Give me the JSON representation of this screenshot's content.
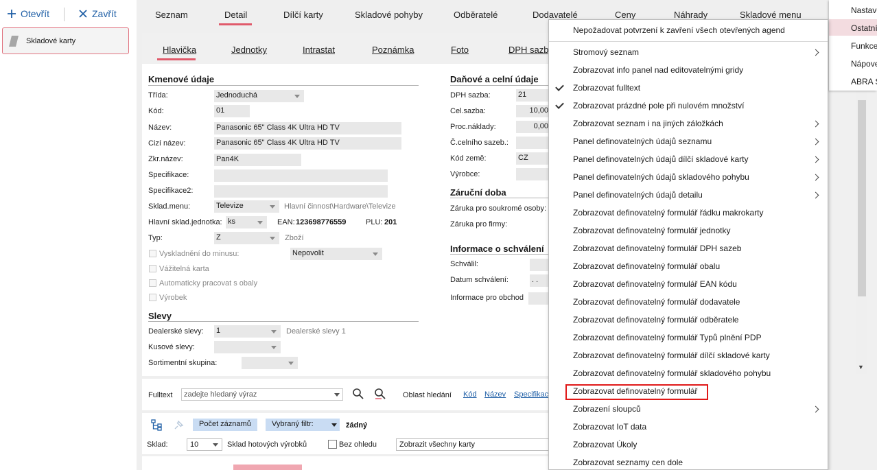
{
  "toolbar": {
    "open_label": "Otevřít",
    "close_label": "Zavřít"
  },
  "sidebar": {
    "card_label": "Skladové karty"
  },
  "top_tabs": [
    "Seznam",
    "Detail",
    "Dílčí karty",
    "Skladové pohyby",
    "Odběratelé",
    "Dodavatelé",
    "Ceny",
    "Náhrady",
    "Skladové menu"
  ],
  "sub_tabs": [
    "Hlavička",
    "Jednotky",
    "Intrastat",
    "Poznámka",
    "Foto",
    "DPH sazby"
  ],
  "left_form": {
    "section1": "Kmenové údaje",
    "trida_label": "Třída:",
    "trida_value": "Jednoduchá",
    "kod_label": "Kód:",
    "kod_value": "01",
    "nazev_label": "Název:",
    "nazev_value": "Panasonic 65\" Class 4K Ultra HD TV",
    "cizi_label": "Cizí název:",
    "cizi_value": "Panasonic 65\" Class 4K Ultra HD TV",
    "zkr_label": "Zkr.název:",
    "zkr_value": "Pan4K",
    "spec_label": "Specifikace:",
    "spec2_label": "Specifikace2:",
    "sklad_menu_label": "Sklad.menu:",
    "sklad_menu_value": "Televize",
    "sklad_menu_path": "Hlavní činnost\\Hardware\\Televize",
    "jednotka_label": "Hlavní sklad.jednotka:",
    "jednotka_value": "ks",
    "ean_label": "EAN:",
    "ean_value": "123698776559",
    "plu_label": "PLU:",
    "plu_value": "201",
    "typ_label": "Typ:",
    "typ_value": "Z",
    "typ_text": "Zboží",
    "vysk_label": "Vyskladnění do minusu:",
    "vysk_value": "Nepovolit",
    "vazitelna_label": "Vážitelná karta",
    "obaly_label": "Automaticky pracovat s obaly",
    "vyrobek_label": "Výrobek",
    "section2": "Slevy",
    "dealer_label": "Dealerské slevy:",
    "dealer_value": "1",
    "dealer_text": "Dealerské slevy 1",
    "kusove_label": "Kusové slevy:",
    "sortiment_label": "Sortimentní skupina:"
  },
  "right_form": {
    "section1": "Daňové a celní údaje",
    "dph_label": "DPH sazba:",
    "dph_value": "21",
    "cel_label": "Cel.sazba:",
    "cel_value": "10,00",
    "proc_label": "Proc.náklady:",
    "proc_value": "0,00",
    "celni_label": "Č.celního sazeb.:",
    "zeme_label": "Kód země:",
    "zeme_value": "CZ",
    "vyrobce_label": "Výrobce:",
    "section2": "Záruční doba",
    "soukr_label": "Záruka pro soukromé osoby:",
    "firmy_label": "Záruka pro firmy:",
    "section3": "Informace o schválení",
    "schvalil_label": "Schválil:",
    "datum_label": "Datum schválení:",
    "datum_value": ". .",
    "obchod_label": "Informace pro obchod"
  },
  "fulltext": {
    "label": "Fulltext",
    "placeholder": "zadejte hledaný výraz",
    "oblast_label": "Oblast hledání",
    "links": [
      "Kód",
      "Název",
      "Specifikace"
    ]
  },
  "bottom": {
    "pocet_label": "Počet záznamů",
    "filtr_label": "Vybraný filtr:",
    "filtr_value": "žádný",
    "sklad_label": "Sklad:",
    "sklad_value": "10",
    "sklad_name": "Sklad hotových výrobků",
    "bez_label": "Bez ohledu",
    "karty_value": "Zobrazit všechny karty"
  },
  "right_menu": [
    "Nastave",
    "Ostatní",
    "Funkce",
    "Nápove",
    "ABRA S"
  ],
  "context_menu": [
    "Nepožadovat potvrzení k zavření všech otevřených agend",
    "Stromový seznam",
    "Zobrazovat info panel nad editovatelnými gridy",
    "Zobrazovat fulltext",
    "Zobrazovat prázdné pole při nulovém množství",
    "Zobrazovat seznam i na jiných záložkách",
    "Panel definovatelných údajů seznamu",
    "Panel definovatelných údajů dílčí skladové karty",
    "Panel definovatelných údajů skladového pohybu",
    "Panel definovatelných údajů detailu",
    "Zobrazovat definovatelný formulář řádku makrokarty",
    "Zobrazovat definovatelný formulář jednotky",
    "Zobrazovat definovatelný formulář DPH sazeb",
    "Zobrazovat definovatelný formulář obalu",
    "Zobrazovat definovatelný formulář EAN kódu",
    "Zobrazovat definovatelný formulář dodavatele",
    "Zobrazovat definovatelný formulář odběratele",
    "Zobrazovat definovatelný formulář Typů plnění PDP",
    "Zobrazovat definovatelný formulář dílčí skladové karty",
    "Zobrazovat definovatelný formulář skladového pohybu",
    "Zobrazovat definovatelný formulář",
    "Zobrazení sloupců",
    "Zobrazovat IoT data",
    "Zobrazovat Úkoly",
    "Zobrazovat seznamy cen dole"
  ],
  "colors": {
    "accent": "#e05a6b",
    "link": "#1f5fa6",
    "highlight_box": "#e01818"
  }
}
